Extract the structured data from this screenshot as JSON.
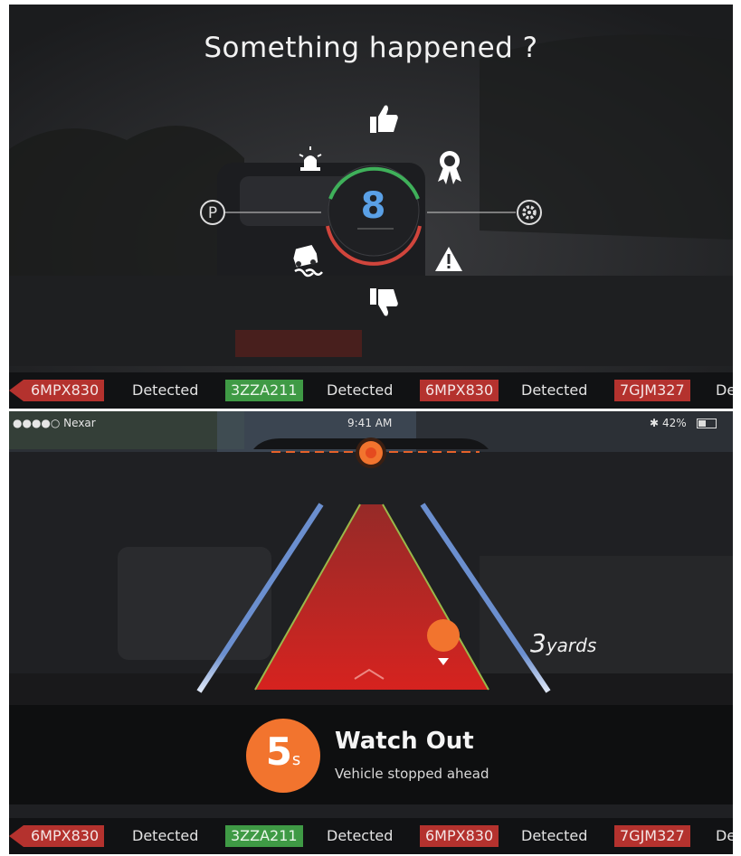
{
  "top_panel": {
    "title": "Something happened ?",
    "score": "8",
    "icons": [
      "thumbs-up-icon",
      "beacon-light-icon",
      "award-ribbon-icon",
      "parking-icon",
      "settings-gear-icon",
      "skid-car-icon",
      "warning-triangle-icon",
      "thumbs-down-icon"
    ],
    "ticker": [
      {
        "plate": "6MPX830",
        "status": "Detected",
        "color": "red"
      },
      {
        "plate": "3ZZA211",
        "status": "Detected",
        "color": "green"
      },
      {
        "plate": "6MPX830",
        "status": "Detected",
        "color": "red"
      },
      {
        "plate": "7GJM327",
        "status": "De",
        "color": "red"
      }
    ]
  },
  "bottom_panel": {
    "status_bar": {
      "carrier": "●●●●○ Nexar",
      "time": "9:41 AM",
      "battery": "42%"
    },
    "distance_number": "3",
    "distance_unit": "yards",
    "countdown_number": "5",
    "countdown_unit": "s",
    "alert_title": "Watch Out",
    "alert_subtitle": "Vehicle stopped ahead",
    "ticker": [
      {
        "plate": "6MPX830",
        "status": "Detected",
        "color": "red"
      },
      {
        "plate": "3ZZA211",
        "status": "Detected",
        "color": "green"
      },
      {
        "plate": "6MPX830",
        "status": "Detected",
        "color": "red"
      },
      {
        "plate": "7GJM327",
        "status": "De",
        "color": "red"
      }
    ]
  },
  "colors": {
    "accent_orange": "#f2742e",
    "plate_red": "#b4322e",
    "plate_green": "#3f9a45",
    "score_blue": "#5aa0e6"
  }
}
